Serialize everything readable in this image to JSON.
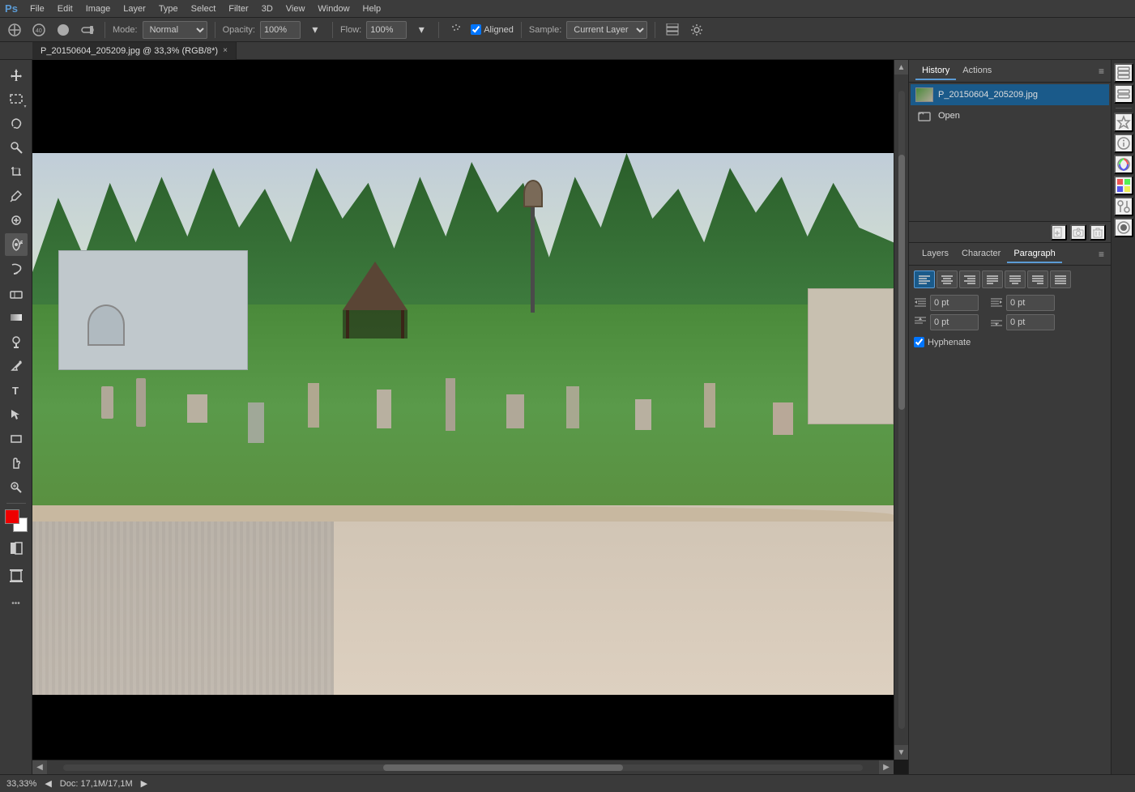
{
  "app": {
    "logo": "Ps",
    "title": "Adobe Photoshop"
  },
  "menubar": {
    "items": [
      "File",
      "Edit",
      "Image",
      "Layer",
      "Type",
      "Select",
      "Filter",
      "3D",
      "View",
      "Window",
      "Help"
    ]
  },
  "toolbar": {
    "brush_size": "40",
    "mode_label": "Mode:",
    "mode_value": "Normal",
    "opacity_label": "Opacity:",
    "opacity_value": "100%",
    "flow_label": "Flow:",
    "flow_value": "100%",
    "aligned_label": "Aligned",
    "sample_label": "Sample:",
    "sample_value": "Current Layer"
  },
  "tab": {
    "filename": "P_20150604_205209.jpg @ 33,3% (RGB/8*)",
    "close": "×"
  },
  "history_panel": {
    "tab1": "History",
    "tab2": "Actions",
    "items": [
      {
        "label": "P_20150604_205209.jpg"
      },
      {
        "label": "Open"
      }
    ]
  },
  "bottom_panel": {
    "new_snapshot": "📷",
    "delete": "🗑"
  },
  "layers_panel": {
    "tab1": "Layers",
    "tab2": "Character",
    "tab3": "Paragraph"
  },
  "paragraph": {
    "align_left": "≡",
    "align_center": "≡",
    "align_right": "≡",
    "justify_left": "≡",
    "justify_center": "≡",
    "justify_right": "≡",
    "justify_all": "≡",
    "indent_left_label": "0 pt",
    "indent_right_label": "0 pt",
    "space_before_label": "0 pt",
    "space_after_label": "0 pt",
    "hyphenate_label": "Hyphenate"
  },
  "statusbar": {
    "zoom": "33,33%",
    "doc_info": "Doc: 17,1M/17,1M",
    "nav_left": "◀",
    "nav_right": "▶"
  },
  "select_menu": "Select"
}
